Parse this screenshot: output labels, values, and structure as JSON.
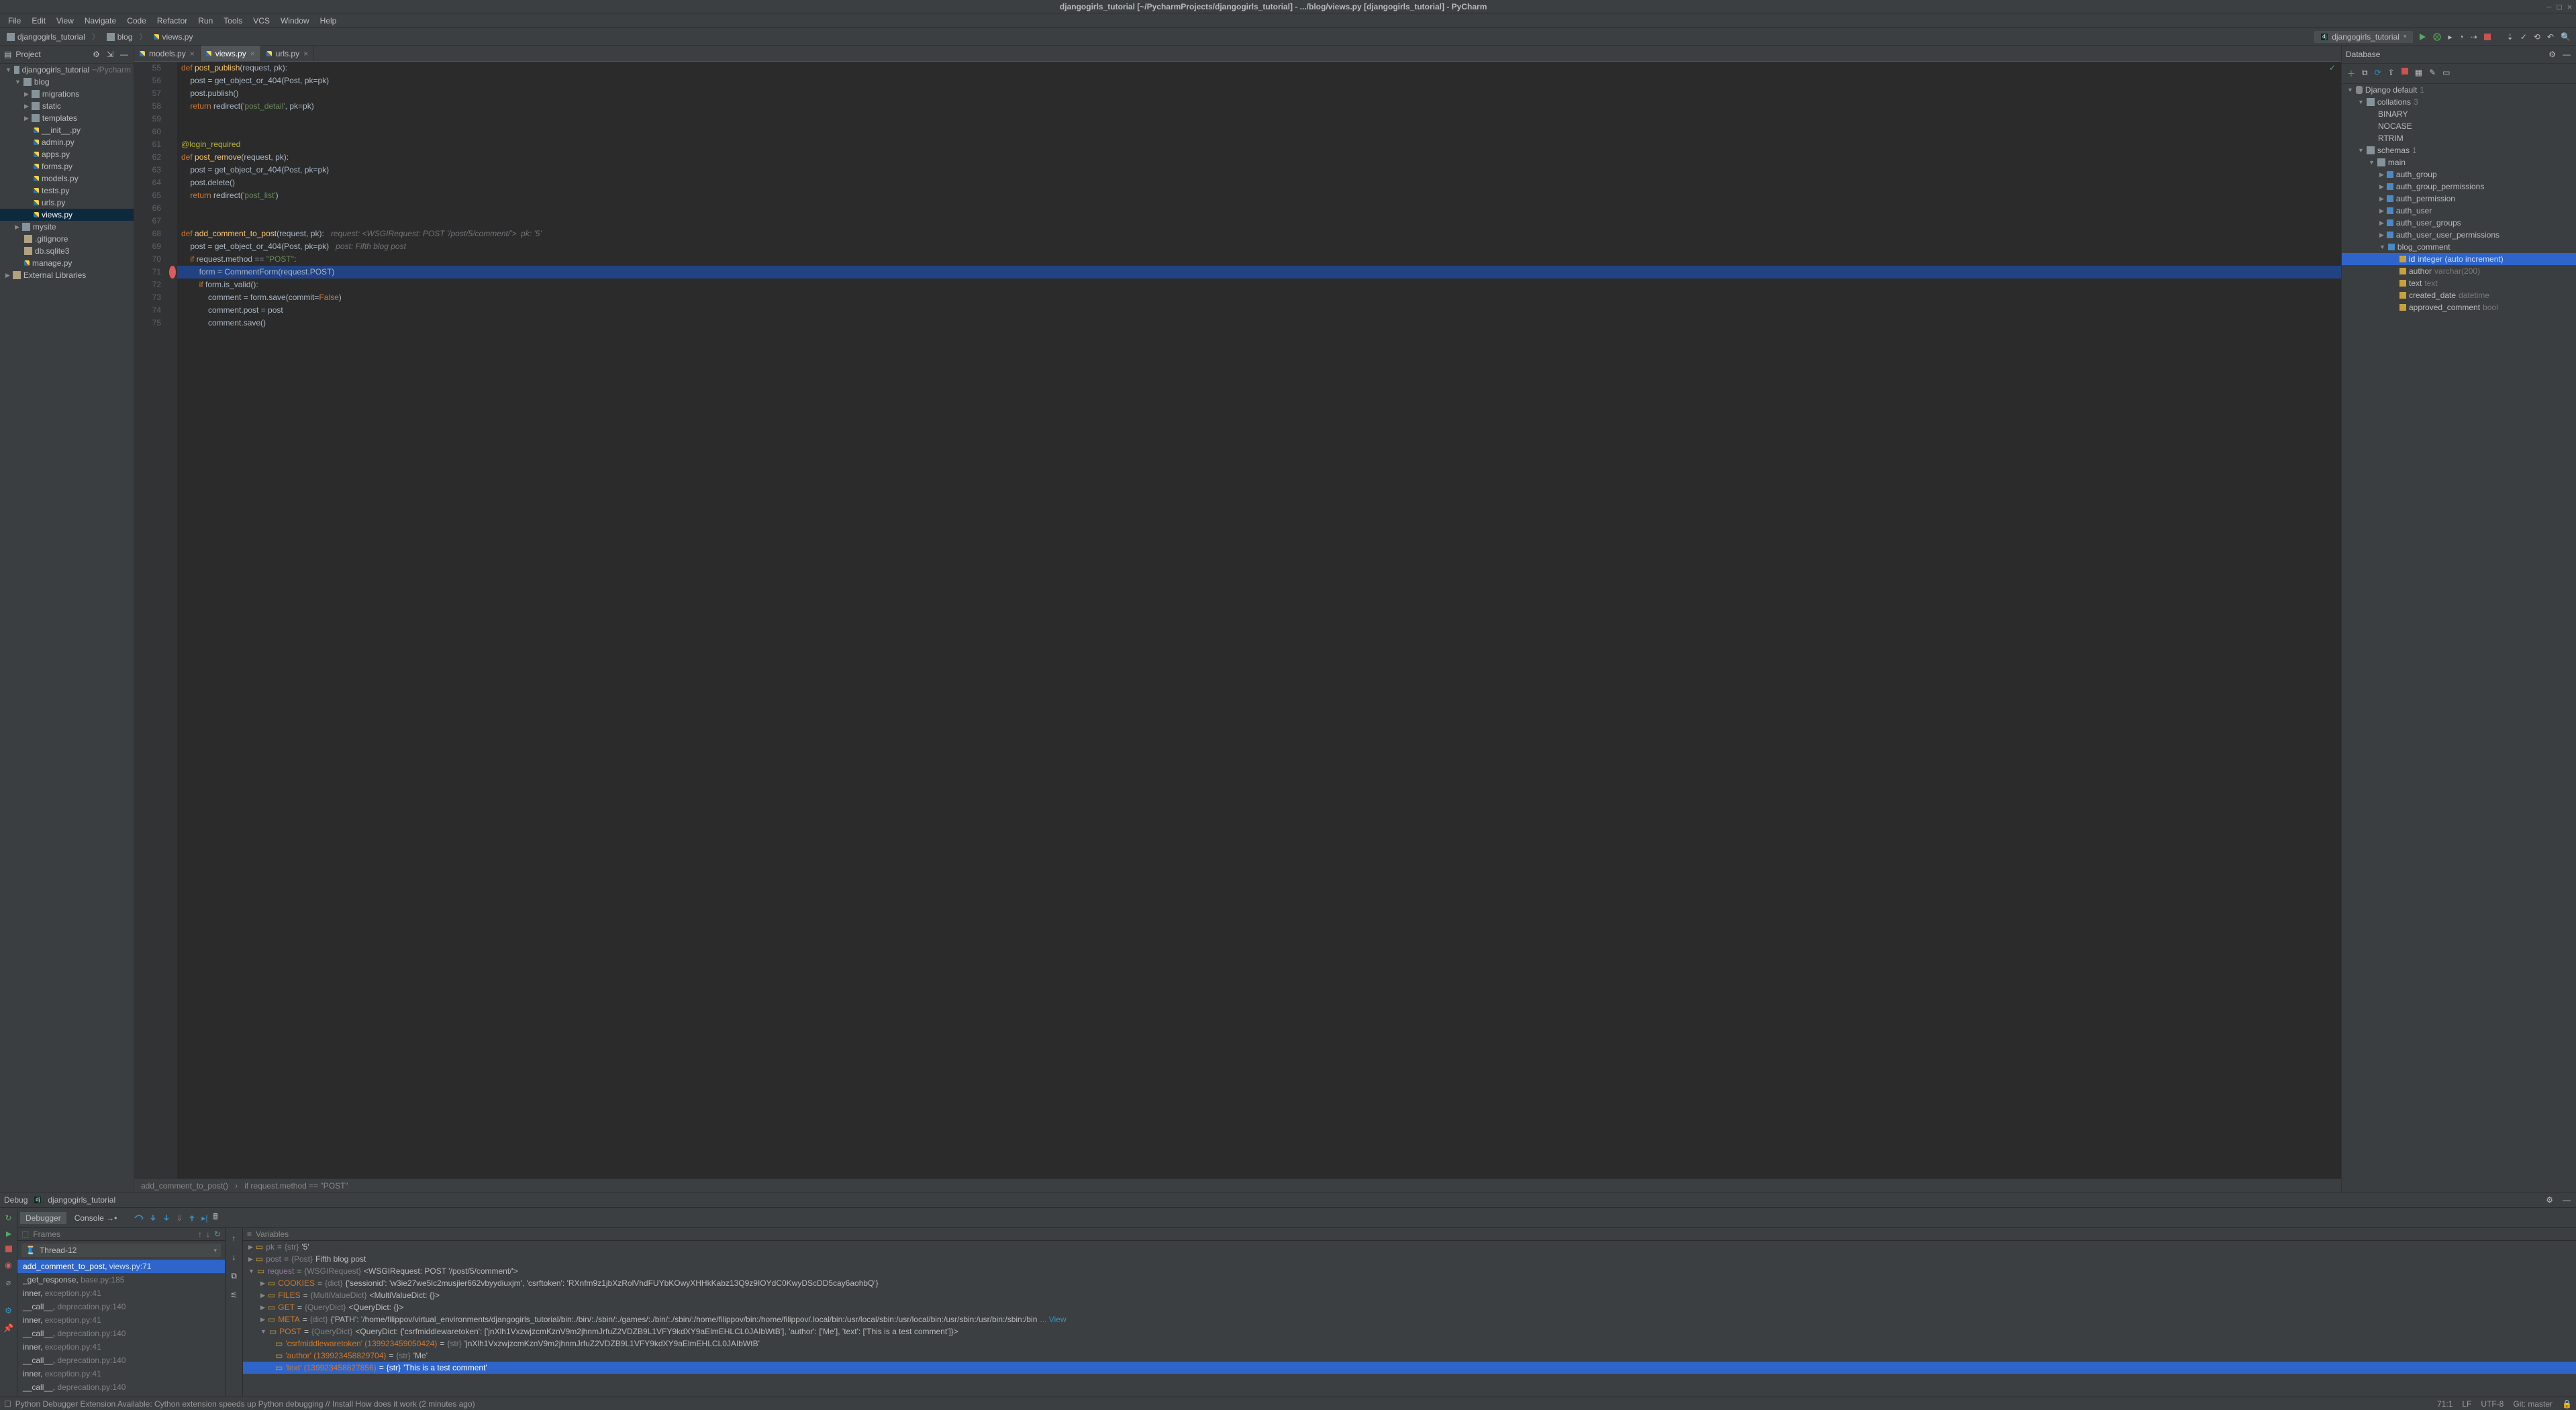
{
  "title": "djangogirls_tutorial [~/PycharmProjects/djangogirls_tutorial] - .../blog/views.py [djangogirls_tutorial] - PyCharm",
  "menu": [
    "File",
    "Edit",
    "View",
    "Navigate",
    "Code",
    "Refactor",
    "Run",
    "Tools",
    "VCS",
    "Window",
    "Help"
  ],
  "crumbs": [
    "djangogirls_tutorial",
    "blog",
    "views.py"
  ],
  "run_config": "djangogirls_tutorial",
  "project_panel_title": "Project",
  "project_tree": {
    "root": "djangogirls_tutorial",
    "root_hint": "~/Pycharm",
    "blog_children": [
      "migrations",
      "static",
      "templates",
      "__init__.py",
      "admin.py",
      "apps.py",
      "forms.py",
      "models.py",
      "tests.py",
      "urls.py",
      "views.py"
    ],
    "mysite": "mysite",
    "other": [
      ".gitignore",
      "db.sqlite3",
      "manage.py"
    ],
    "ext_lib": "External Libraries"
  },
  "tabs": [
    "models.py",
    "views.py",
    "urls.py"
  ],
  "active_tab": 1,
  "line_start": 55,
  "code_lines": [
    {
      "n": 55,
      "seg": [
        [
          "kw",
          "def "
        ],
        [
          "fn",
          "post_publish"
        ],
        [
          "op",
          "(request, pk):"
        ]
      ]
    },
    {
      "n": 56,
      "seg": [
        [
          "op",
          "    post = get_object_or_404(Post, "
        ],
        [
          "op",
          "pk"
        ],
        [
          "op",
          "=pk)"
        ]
      ]
    },
    {
      "n": 57,
      "seg": [
        [
          "op",
          "    post.publish()"
        ]
      ]
    },
    {
      "n": 58,
      "seg": [
        [
          "op",
          "    "
        ],
        [
          "kw",
          "return "
        ],
        [
          "op",
          "redirect("
        ],
        [
          "str",
          "'post_detail'"
        ],
        [
          "op",
          ", "
        ],
        [
          "op",
          "pk"
        ],
        [
          "op",
          "=pk)"
        ]
      ]
    },
    {
      "n": 59,
      "seg": []
    },
    {
      "n": 60,
      "seg": []
    },
    {
      "n": 61,
      "seg": [
        [
          "dec",
          "@login_required"
        ]
      ]
    },
    {
      "n": 62,
      "seg": [
        [
          "kw",
          "def "
        ],
        [
          "fn",
          "post_remove"
        ],
        [
          "op",
          "(request, pk):"
        ]
      ]
    },
    {
      "n": 63,
      "seg": [
        [
          "op",
          "    post = get_object_or_404(Post, "
        ],
        [
          "op",
          "pk"
        ],
        [
          "op",
          "=pk)"
        ]
      ]
    },
    {
      "n": 64,
      "seg": [
        [
          "op",
          "    post.delete()"
        ]
      ]
    },
    {
      "n": 65,
      "seg": [
        [
          "op",
          "    "
        ],
        [
          "kw",
          "return "
        ],
        [
          "op",
          "redirect("
        ],
        [
          "str",
          "'post_list'"
        ],
        [
          "op",
          ")"
        ]
      ]
    },
    {
      "n": 66,
      "seg": []
    },
    {
      "n": 67,
      "seg": []
    },
    {
      "n": 68,
      "seg": [
        [
          "kw",
          "def "
        ],
        [
          "fn",
          "add_comment_to_post"
        ],
        [
          "op",
          "(request, pk):   "
        ],
        [
          "hint",
          "request: <WSGIRequest: POST '/post/5/comment/'>  pk: '5'"
        ]
      ]
    },
    {
      "n": 69,
      "seg": [
        [
          "op",
          "    post = get_object_or_404(Post, "
        ],
        [
          "op",
          "pk"
        ],
        [
          "op",
          "=pk)   "
        ],
        [
          "hint",
          "post: Fifth blog post"
        ]
      ]
    },
    {
      "n": 70,
      "seg": [
        [
          "op",
          "    "
        ],
        [
          "kw",
          "if "
        ],
        [
          "op",
          "request.method == "
        ],
        [
          "str",
          "\"POST\""
        ],
        [
          "op",
          ":"
        ]
      ]
    },
    {
      "n": 71,
      "hl": true,
      "bp": true,
      "seg": [
        [
          "op",
          "        form = CommentForm(request.POST)"
        ]
      ]
    },
    {
      "n": 72,
      "seg": [
        [
          "op",
          "        "
        ],
        [
          "kw",
          "if "
        ],
        [
          "op",
          "form.is_valid():"
        ]
      ]
    },
    {
      "n": 73,
      "seg": [
        [
          "op",
          "            comment = form.save("
        ],
        [
          "op",
          "commit"
        ],
        [
          "op",
          "="
        ],
        [
          "kw",
          "False"
        ],
        [
          "op",
          ")"
        ]
      ]
    },
    {
      "n": 74,
      "seg": [
        [
          "op",
          "            comment.post = post"
        ]
      ]
    },
    {
      "n": 75,
      "seg": [
        [
          "op",
          "            comment.save()"
        ]
      ]
    }
  ],
  "sub_crumbs": [
    "add_comment_to_post()",
    "if request.method == \"POST\""
  ],
  "db_panel_title": "Database",
  "db_root": "Django default",
  "db_root_count": "1",
  "db_collations": "collations",
  "db_collations_count": "3",
  "db_collations_items": [
    "BINARY",
    "NOCASE",
    "RTRIM"
  ],
  "db_schemas": "schemas",
  "db_schemas_count": "1",
  "db_main": "main",
  "db_tables": [
    "auth_group",
    "auth_group_permissions",
    "auth_permission",
    "auth_user",
    "auth_user_groups",
    "auth_user_user_permissions",
    "blog_comment"
  ],
  "db_columns": [
    {
      "name": "id",
      "type": "integer (auto increment)",
      "pk": true
    },
    {
      "name": "author",
      "type": "varchar(200)"
    },
    {
      "name": "text",
      "type": "text"
    },
    {
      "name": "created_date",
      "type": "datetime"
    },
    {
      "name": "approved_comment",
      "type": "bool"
    }
  ],
  "debug_label": "Debug",
  "debug_config": "djangogirls_tutorial",
  "debug_tabs": [
    "Debugger",
    "Console"
  ],
  "frames_title": "Frames",
  "thread": "Thread-12",
  "frames": [
    "add_comment_to_post, views.py:71",
    "_get_response, base.py:185",
    "inner, exception.py:41",
    "__call__, deprecation.py:140",
    "inner, exception.py:41",
    "__call__, deprecation.py:140",
    "inner, exception.py:41",
    "__call__, deprecation.py:140",
    "inner, exception.py:41",
    "__call__, deprecation.py:140"
  ],
  "vars_title": "Variables",
  "vars": {
    "pk": {
      "type": "{str}",
      "val": "'5'"
    },
    "post": {
      "type": "{Post}",
      "val": "Fifth blog post"
    },
    "request": {
      "type": "{WSGIRequest}",
      "val": "<WSGIRequest: POST '/post/5/comment/'>"
    },
    "cookies": {
      "type": "{dict}",
      "val": "{'sessionid': 'w3ie27we5lc2musjier662vbyydiuxjm', 'csrftoken': 'RXnfm9z1jbXzRolVhdFUYbKOwyXHHkKabz13Q9z9IOYdC0KwyDScDD5cay6aohbQ'}"
    },
    "files": {
      "type": "{MultiValueDict}",
      "val": "<MultiValueDict: {}>"
    },
    "get": {
      "type": "{QueryDict}",
      "val": "<QueryDict: {}>"
    },
    "meta": {
      "type": "{dict}",
      "val": "{'PATH': '/home/filippov/virtual_environments/djangogirls_tutorial/bin:./bin/:./sbin/:./games/:./bin/:./sbin/:/home/filippov/bin:/home/filippov/.local/bin:/usr/local/sbin:/usr/local/bin:/usr/sbin:/usr/bin:/sbin:/bin"
    },
    "meta_tail": "View",
    "post_dict": {
      "type": "{QueryDict}",
      "val": "<QueryDict: {'csrfmiddlewaretoken': ['jnXlh1VxzwjzcmKznV9m2jhnmJrfuZ2VDZB9L1VFY9kdXY9aElmEHLCL0JAIbWtB'], 'author': ['Me'], 'text': ['This is a test comment']}>"
    },
    "csrf": {
      "key": "'csrfmiddlewaretoken' (139923459050424)",
      "type": "{str}",
      "val": "'jnXlh1VxzwjzcmKznV9m2jhnmJrfuZ2VDZB9L1VFY9kdXY9aElmEHLCL0JAIbWtB'"
    },
    "author": {
      "key": "'author' (139923458829704)",
      "type": "{str}",
      "val": "'Me'"
    },
    "text": {
      "key": "'text' (139923458827856)",
      "type": "{str}",
      "val": "'This is a test comment'"
    }
  },
  "status_msg": "Python Debugger Extension Available: Cython extension speeds up Python debugging // Install How does it work (2 minutes ago)",
  "status_right": {
    "pos": "71:1",
    "le": "LF",
    "enc": "UTF-8",
    "git": "Git: master",
    "lock": ""
  }
}
